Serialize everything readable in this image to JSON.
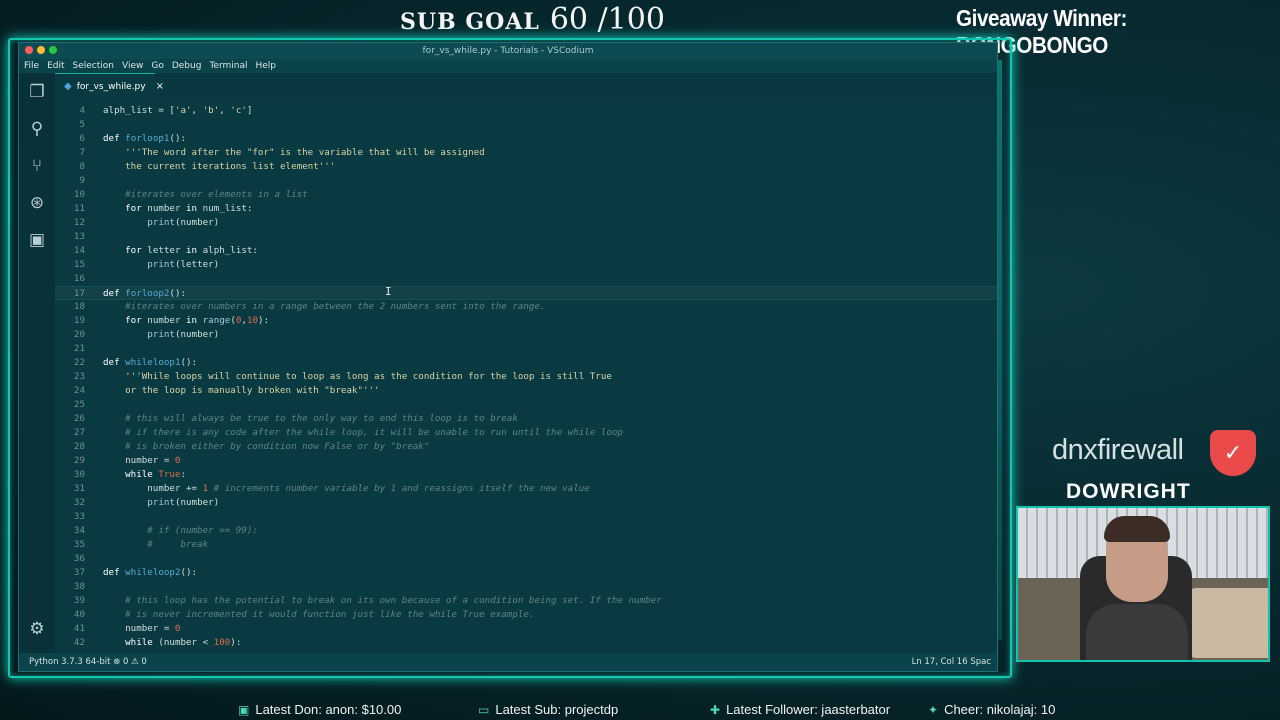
{
  "overlay": {
    "sub_goal_label": "SUB GOAL",
    "sub_goal_count": "60 /100",
    "giveaway": "Giveaway Winner: BONGOBONGO",
    "sponsor": "dnxfirewall",
    "streamer": "DOWRIGHT",
    "latest_don": "Latest Don: anon: $10.00",
    "latest_sub": "Latest Sub: projectdp",
    "latest_follower": "Latest Follower: jaasterbator",
    "cheer": "Cheer: nikolajaj: 10"
  },
  "window": {
    "title": "for_vs_while.py - Tutorials - VSCodium",
    "traffic_colors": [
      "#ff5f57",
      "#febc2e",
      "#28c840"
    ]
  },
  "menu": [
    "File",
    "Edit",
    "Selection",
    "View",
    "Go",
    "Debug",
    "Terminal",
    "Help"
  ],
  "activity_icons": [
    "files-icon",
    "search-icon",
    "source-control-icon",
    "debug-icon",
    "extensions-icon"
  ],
  "tab": {
    "label": "for_vs_while.py",
    "close_glyph": "×"
  },
  "code_lines": [
    {
      "n": "4",
      "html": "alph_list = [<span class='str'>'a'</span>, <span class='str'>'b'</span>, <span class='str'>'c'</span>]"
    },
    {
      "n": "5",
      "html": ""
    },
    {
      "n": "6",
      "html": "<span class='kw'>def</span> <span class='fn'>forloop1</span>():"
    },
    {
      "n": "7",
      "html": "    <span class='str'>'''The word after the \"for\" is the variable that will be assigned</span>"
    },
    {
      "n": "8",
      "html": "    <span class='str'>the current iterations list element'''</span>"
    },
    {
      "n": "9",
      "html": ""
    },
    {
      "n": "10",
      "html": "    <span class='cm'>#iterates over elements in a list</span>"
    },
    {
      "n": "11",
      "html": "    <span class='kw'>for</span> number <span class='kw'>in</span> num_list:"
    },
    {
      "n": "12",
      "html": "        <span class='bi'>print</span>(number)"
    },
    {
      "n": "13",
      "html": ""
    },
    {
      "n": "14",
      "html": "    <span class='kw'>for</span> letter <span class='kw'>in</span> alph_list:"
    },
    {
      "n": "15",
      "html": "        <span class='bi'>print</span>(letter)"
    },
    {
      "n": "16",
      "html": ""
    },
    {
      "n": "17",
      "html": "<span class='kw'>def</span> <span class='fn'>forloop2</span>():",
      "current": true
    },
    {
      "n": "18",
      "html": "    <span class='cm'>#iterates over numbers in a range between the 2 numbers sent into the range.</span>"
    },
    {
      "n": "19",
      "html": "    <span class='kw'>for</span> number <span class='kw'>in</span> <span class='bi'>range</span>(<span class='num'>0</span>,<span class='num'>10</span>):"
    },
    {
      "n": "20",
      "html": "        <span class='bi'>print</span>(number)"
    },
    {
      "n": "21",
      "html": ""
    },
    {
      "n": "22",
      "html": "<span class='kw'>def</span> <span class='fn'>whileloop1</span>():"
    },
    {
      "n": "23",
      "html": "    <span class='str'>'''While loops will continue to loop as long as the condition for the loop is still True</span>"
    },
    {
      "n": "24",
      "html": "    <span class='str'>or the loop is manually broken with \"break\"'''</span>"
    },
    {
      "n": "25",
      "html": ""
    },
    {
      "n": "26",
      "html": "    <span class='cm'># this will always be true to the only way to end this loop is to break</span>"
    },
    {
      "n": "27",
      "html": "    <span class='cm'># if there is any code after the while loop, it will be unable to run until the while loop</span>"
    },
    {
      "n": "28",
      "html": "    <span class='cm'># is broken either by condition now False or by \"break\"</span>"
    },
    {
      "n": "29",
      "html": "    number = <span class='num'>0</span>"
    },
    {
      "n": "30",
      "html": "    <span class='kw'>while</span> <span class='num'>True</span>:"
    },
    {
      "n": "31",
      "html": "        number += <span class='num'>1</span> <span class='cm'># increments number variable by 1 and reassigns itself the new value</span>"
    },
    {
      "n": "32",
      "html": "        <span class='bi'>print</span>(number)"
    },
    {
      "n": "33",
      "html": ""
    },
    {
      "n": "34",
      "html": "        <span class='cm'># if (number == 99):</span>"
    },
    {
      "n": "35",
      "html": "        <span class='cm'>#     break</span>"
    },
    {
      "n": "36",
      "html": ""
    },
    {
      "n": "37",
      "html": "<span class='kw'>def</span> <span class='fn'>whileloop2</span>():"
    },
    {
      "n": "38",
      "html": ""
    },
    {
      "n": "39",
      "html": "    <span class='cm'># this loop has the potential to break on its own because of a condition being set. If the number</span>"
    },
    {
      "n": "40",
      "html": "    <span class='cm'># is never incremented it would function just like the while True example.</span>"
    },
    {
      "n": "41",
      "html": "    number = <span class='num'>0</span>"
    },
    {
      "n": "42",
      "html": "    <span class='kw'>while</span> (number &lt; <span class='num'>100</span>):"
    }
  ],
  "status": {
    "left": "Python 3.7.3 64-bit  ⊗ 0 ⚠ 0",
    "right": "Ln 17, Col 16    Spac"
  }
}
